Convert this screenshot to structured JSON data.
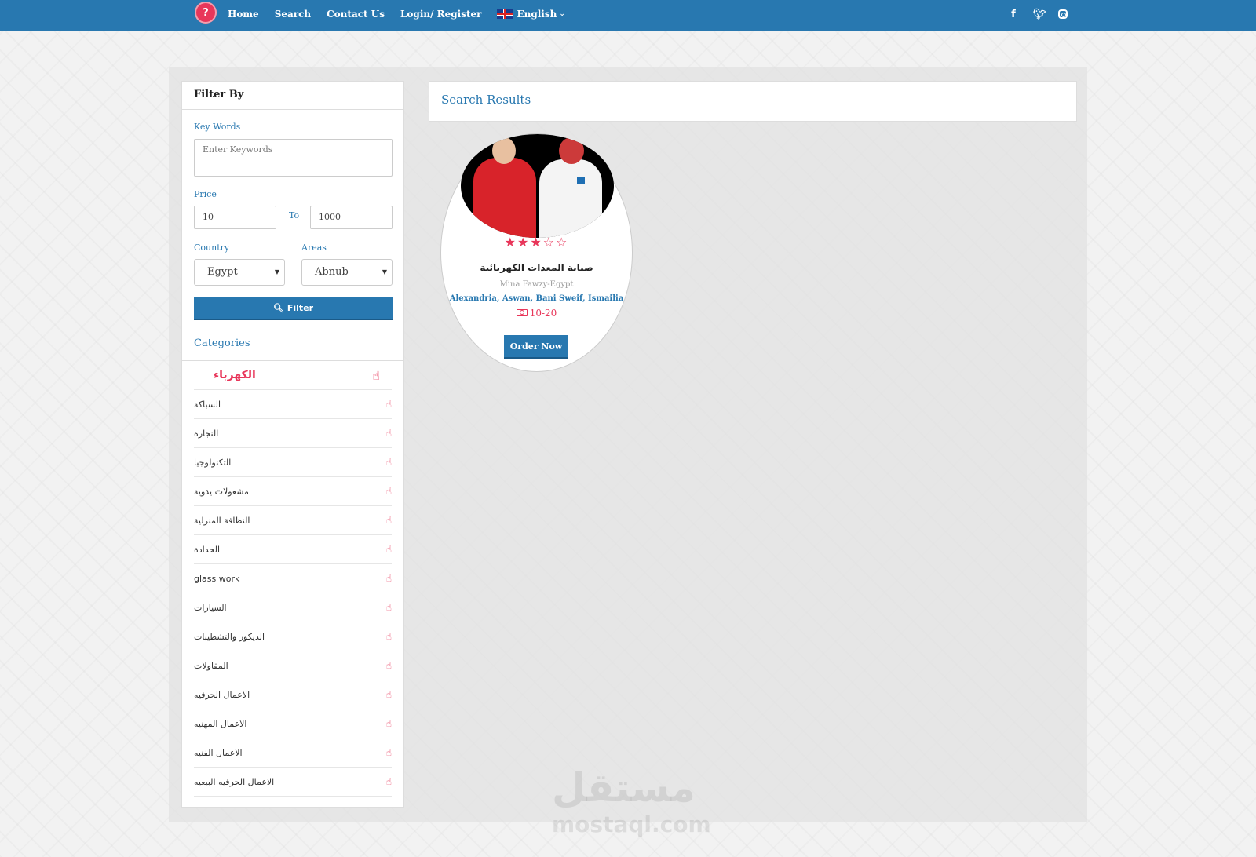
{
  "nav": {
    "logo": "?",
    "links": [
      "Home",
      "Search",
      "Contact Us",
      "Login/ Register"
    ],
    "language": "English",
    "social": [
      "facebook-icon",
      "twitter-icon",
      "instagram-icon"
    ]
  },
  "filter": {
    "title": "Filter By",
    "keywords_label": "Key Words",
    "keywords_placeholder": "Enter Keywords",
    "price_label": "Price",
    "price_from": "10",
    "price_to_label": "To",
    "price_to": "1000",
    "country_label": "Country",
    "country_value": "Egypt",
    "areas_label": "Areas",
    "areas_value": "Abnub",
    "button_label": "Filter"
  },
  "categories": {
    "title": "Categories",
    "active": "الكهرباء",
    "items": [
      "السباكة",
      "النجارة",
      "التكنولوجيا",
      "مشغولات يدوية",
      "النظافة المنزلية",
      "الحدادة",
      "glass work",
      "السيارات",
      "الديكور والتشطيبات",
      "المقاولات",
      "الاعمال الحرفيه",
      "الاعمال المهنيه",
      "الاعمال الفنيه",
      "الاعمال الحرفيه البيعيه"
    ]
  },
  "results": {
    "title": "Search Results",
    "card": {
      "rating": 3,
      "rating_max": 5,
      "title": "صيانة المعدات الكهربائية",
      "owner": "Mina Fawzy-Egypt",
      "areas": "Alexandria, Aswan, Bani Sweif, Ismailia",
      "price": "10-20",
      "button_label": "Order Now"
    }
  },
  "watermark": {
    "arabic": "مستقل",
    "latin": "mostaql.com"
  },
  "colors": {
    "primary": "#2878b0",
    "accent": "#e8365a"
  }
}
